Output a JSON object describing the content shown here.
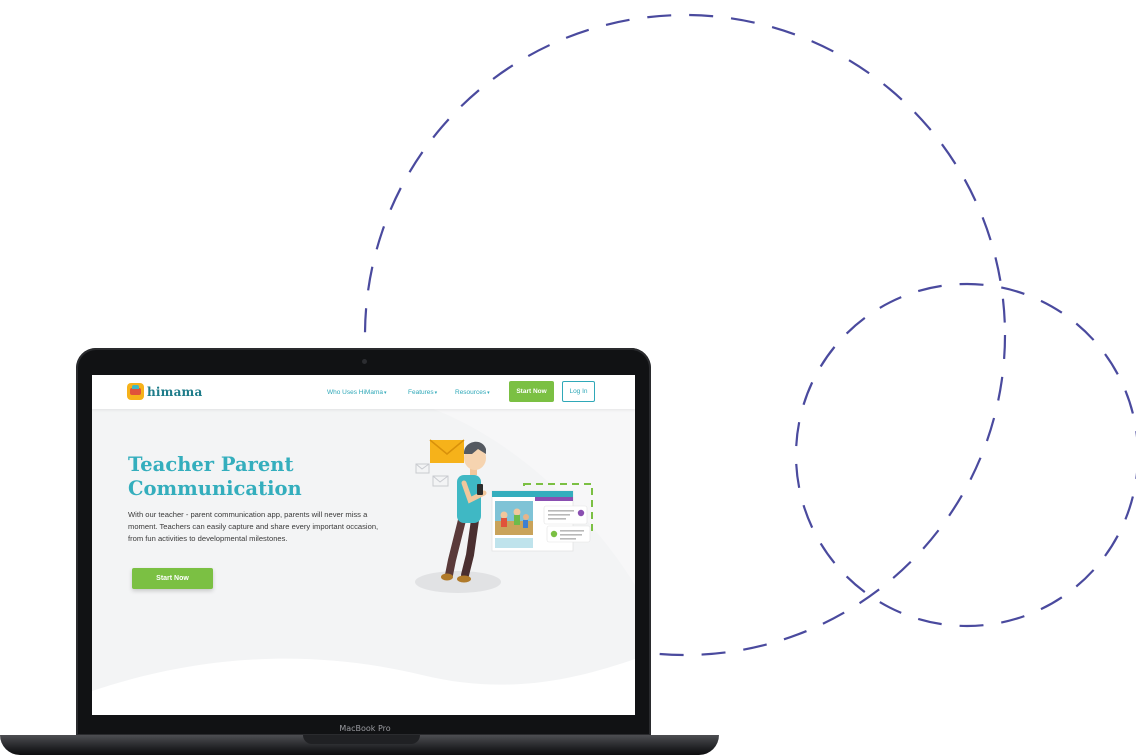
{
  "laptop": {
    "brand_label": "MacBook Pro"
  },
  "site": {
    "logo_text": "himama",
    "nav": {
      "items": [
        {
          "label": "Who Uses HiMama"
        },
        {
          "label": "Features"
        },
        {
          "label": "Resources"
        }
      ],
      "start_label": "Start Now",
      "login_label": "Log In"
    },
    "hero": {
      "title_line1": "Teacher Parent",
      "title_line2": "Communication",
      "body": "With our teacher - parent communication app, parents will never miss a moment. Teachers can easily capture and share every important occasion, from fun activities to developmental milestones.",
      "cta_label": "Start Now"
    }
  },
  "colors": {
    "accent_teal": "#34aebd",
    "accent_green": "#7bc043",
    "decoration_stroke": "#4a4a9e"
  },
  "icons": {
    "caret": "chevron-down-icon",
    "envelope": "envelope-icon"
  }
}
